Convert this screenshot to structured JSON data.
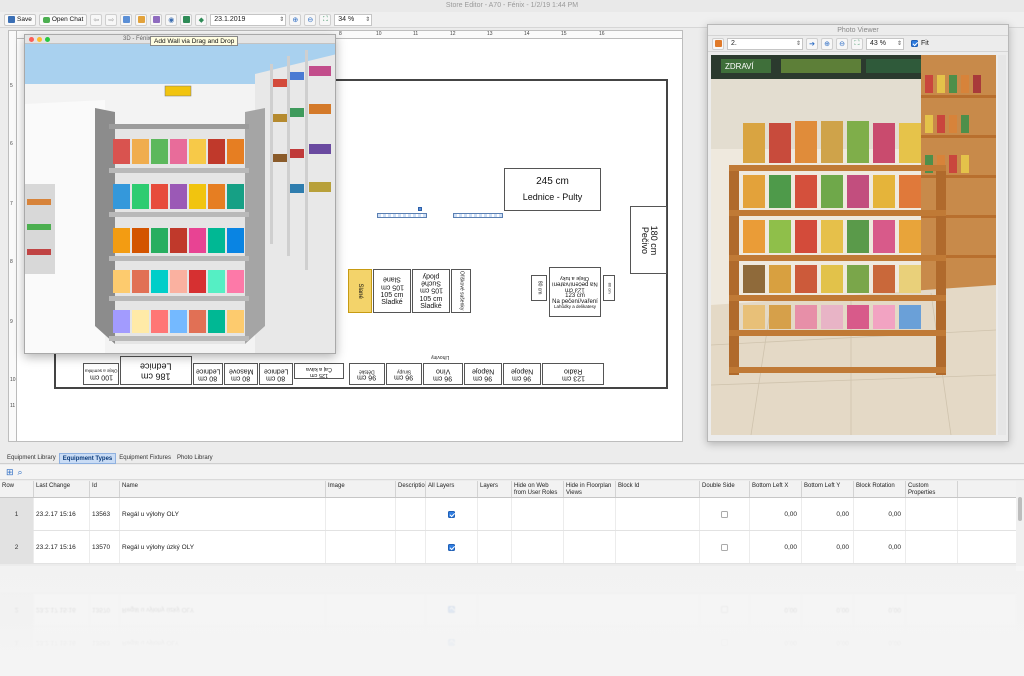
{
  "window_title": "Store Editor - A70 - Fénix - 1/2/19 1:44 PM",
  "toolbar": {
    "save_label": "Save",
    "open_chat_label": "Open Chat",
    "date_value": "23.1.2019",
    "zoom_value": "34 %"
  },
  "tooltip": "Add Wall via Drag and Drop",
  "win3d_title": "3D - Fénix",
  "plan": {
    "ruler_top": [
      "8",
      "9",
      "10",
      "11",
      "12",
      "13",
      "14",
      "15",
      "16"
    ],
    "ruler_left": [
      "5",
      "6",
      "7",
      "8",
      "9",
      "10",
      "11"
    ],
    "labels": {
      "lednice_pulty_size": "245 cm",
      "lednice_pulty_name": "Lednice - Pulty",
      "pecivo_size": "180 cm",
      "pecivo_name": "Pečivo",
      "slane_size": "105 cm",
      "slane_name": "Slané",
      "slane_top": "Slané",
      "sladke1_size": "105 cm",
      "sladke1_name": "Sladké",
      "sladke2_size": "105 cm",
      "sladke2_name": "Sladké",
      "suche_plody": "Suché plody",
      "small_105": "105 cm",
      "oriskove": "Ořiškové sušenky",
      "napecivo_size": "123 cm",
      "napecivo_name": "Na pečení/vaření",
      "napecivo_top": "123 cm",
      "napecivo_top_name": "Na pečení/vaření",
      "lahudky": "Lahůdky a delikatesy",
      "cisla_a_tuky": "Oleje a tuky",
      "ruler_left_80": "80 cm",
      "ruler_left_80_name": "Sladké",
      "slide_side_left": "80 cm",
      "bottom_100": "100 cm",
      "bottom_100_name": "Oleje a semínka",
      "bottom_lednice_size": "186 cm",
      "bottom_lednice_name": "Lednice",
      "b1_size": "80 cm",
      "b1_name": "Lednice",
      "b2_size": "80 cm",
      "b2_name": "Masové",
      "b3_size": "80 cm",
      "b3_name": "Lednice",
      "b4_size": "125 cm",
      "b4_name": "Čaj a káva",
      "b5_size": "96 cm",
      "b5_name": "Dětské",
      "b6_size": "96 cm",
      "b6_name": "Sirupy",
      "b7_size": "96 cm",
      "b7_name": "Víno",
      "b7_top": "Lihoviny",
      "b8_size": "96 cm",
      "b8_name": "Nápoje",
      "b9_size": "96 cm",
      "b9_name": "Nápoje",
      "b10_size": "123 cm",
      "b10_name": "Rádio",
      "lednice_small_top": "Lednice",
      "slim_80": "80 cm",
      "slim_name": "Nápoje"
    }
  },
  "photo_viewer": {
    "title": "Photo Viewer",
    "image_select": "2.",
    "zoom_value": "43 %",
    "fit_label": "Fit",
    "fit_checked": true,
    "sign_text": "ZDRAVÍ"
  },
  "tabs": [
    {
      "label": "Equipment Library",
      "active": false
    },
    {
      "label": "Equipment Types",
      "active": true
    },
    {
      "label": "Equipment Fixtures",
      "active": false
    },
    {
      "label": "Photo Library",
      "active": false
    }
  ],
  "table": {
    "columns": [
      "Row",
      "Last Change",
      "Id",
      "Name",
      "Image",
      "Description",
      "All Layers",
      "Layers",
      "Hide on Web from User Roles",
      "Hide in Floorplan Views",
      "Block Id",
      "Double Side",
      "Bottom Left X",
      "Bottom Left Y",
      "Block Rotation",
      "Custom Properties"
    ],
    "rows": [
      {
        "row": "1",
        "last_change": "23.2.17 15:16",
        "id": "13563",
        "name": "Regál u výlohy OLY",
        "all_layers": true,
        "double_side": false,
        "bottom_left_x": "0,00",
        "bottom_left_y": "0,00",
        "block_rotation": "0,00"
      },
      {
        "row": "2",
        "last_change": "23.2.17 15:16",
        "id": "13570",
        "name": "Regál u výlohy úzký OLY",
        "all_layers": true,
        "double_side": false,
        "bottom_left_x": "0,00",
        "bottom_left_y": "0,00",
        "block_rotation": "0,00"
      }
    ]
  },
  "colors": {
    "selection_blue": "#2f7de1",
    "tab_active": "#c9dcf5",
    "slane_yellow": "#f3d36a"
  }
}
